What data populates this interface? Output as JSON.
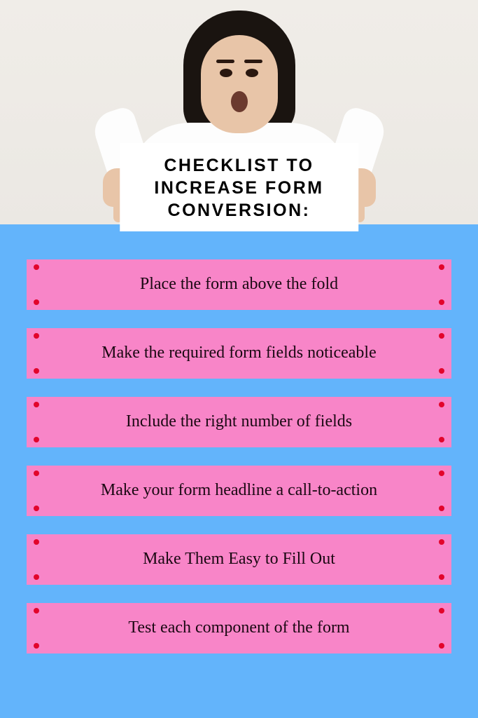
{
  "title": "CHECKLIST TO INCREASE FORM CONVERSION:",
  "checklist": {
    "items": [
      {
        "text": "Place the form above the fold"
      },
      {
        "text": "Make the required form fields noticeable"
      },
      {
        "text": "Include the right number of fields"
      },
      {
        "text": "Make your form headline a call-to-action"
      },
      {
        "text": "Make Them Easy to Fill Out"
      },
      {
        "text": "Test each component of the form"
      }
    ]
  },
  "colors": {
    "background_blue": "#63b4fb",
    "item_pink": "#f885c8",
    "dot_red": "#e2052b"
  }
}
